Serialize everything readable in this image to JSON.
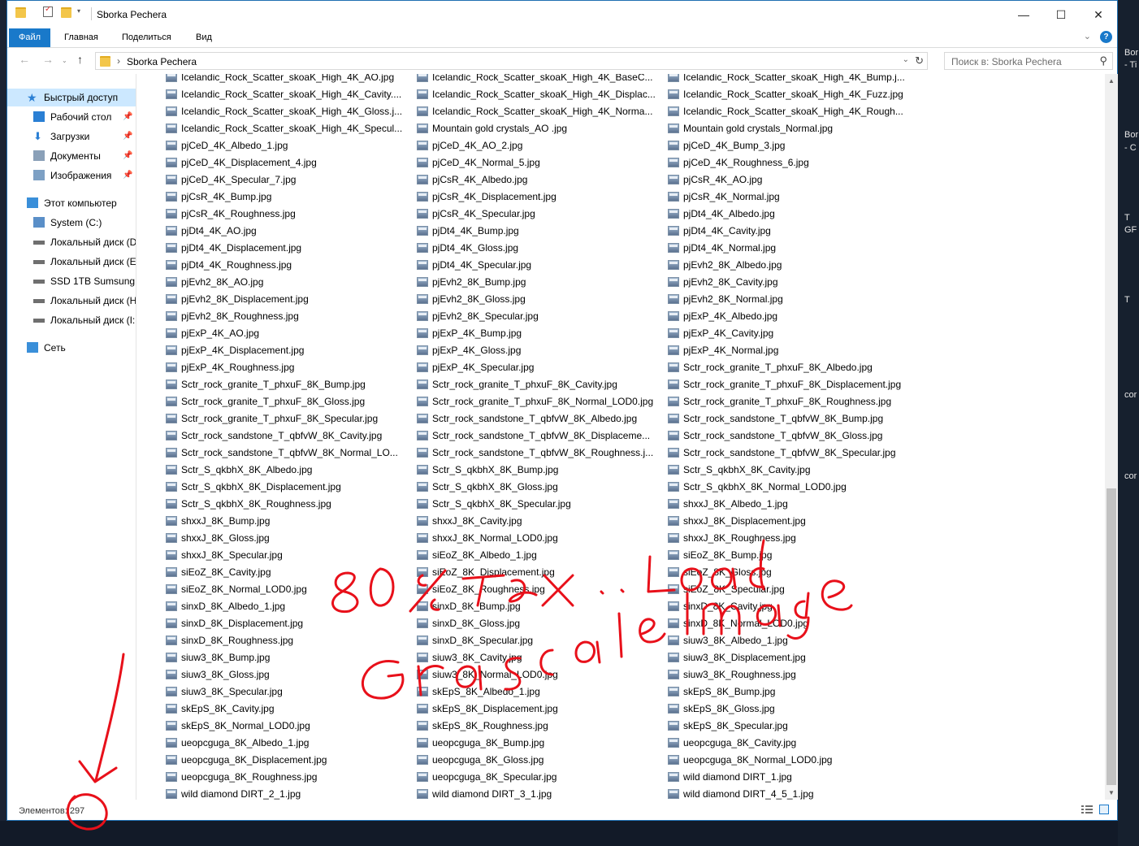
{
  "window": {
    "title": "Sborka Pechera",
    "controls": {
      "minimize": "—",
      "maximize": "☐",
      "close": "✕"
    }
  },
  "ribbon": {
    "tabs": [
      "Файл",
      "Главная",
      "Поделиться",
      "Вид"
    ],
    "help": "?"
  },
  "address": {
    "path": "Sborka Pechera",
    "search_placeholder": "Поиск в: Sborka Pechera"
  },
  "nav": [
    {
      "label": "Быстрый доступ",
      "icon": "star-icon",
      "level": 0,
      "selected": true,
      "pin": false
    },
    {
      "label": "Рабочий стол",
      "icon": "desktop-icon",
      "level": 1,
      "pin": true
    },
    {
      "label": "Загрузки",
      "icon": "download-icon",
      "level": 1,
      "pin": true
    },
    {
      "label": "Документы",
      "icon": "documents-icon",
      "level": 1,
      "pin": true
    },
    {
      "label": "Изображения",
      "icon": "pictures-icon",
      "level": 1,
      "pin": true
    },
    {
      "label": "Этот компьютер",
      "icon": "computer-icon",
      "level": 0,
      "gap": true,
      "pin": false
    },
    {
      "label": "System (C:)",
      "icon": "windows-drive-icon",
      "level": 1,
      "pin": false
    },
    {
      "label": "Локальный диск (D",
      "icon": "drive-icon",
      "level": 1,
      "pin": false
    },
    {
      "label": "Локальный диск (E",
      "icon": "drive-icon",
      "level": 1,
      "pin": false
    },
    {
      "label": "SSD 1TB Sumsung (",
      "icon": "drive-icon",
      "level": 1,
      "pin": false
    },
    {
      "label": "Локальный диск (H",
      "icon": "drive-icon",
      "level": 1,
      "pin": false
    },
    {
      "label": "Локальный диск (I:",
      "icon": "drive-icon",
      "level": 1,
      "pin": false
    },
    {
      "label": "Сеть",
      "icon": "network-icon",
      "level": 0,
      "gap": true,
      "pin": false
    }
  ],
  "files": {
    "col1": [
      "Icelandic_Rock_Scatter_skoaK_High_4K_AO.jpg",
      "Icelandic_Rock_Scatter_skoaK_High_4K_Cavity....",
      "Icelandic_Rock_Scatter_skoaK_High_4K_Gloss.j...",
      "Icelandic_Rock_Scatter_skoaK_High_4K_Specul...",
      "pjCeD_4K_Albedo_1.jpg",
      "pjCeD_4K_Displacement_4.jpg",
      "pjCeD_4K_Specular_7.jpg",
      "pjCsR_4K_Bump.jpg",
      "pjCsR_4K_Roughness.jpg",
      "pjDt4_4K_AO.jpg",
      "pjDt4_4K_Displacement.jpg",
      "pjDt4_4K_Roughness.jpg",
      "pjEvh2_8K_AO.jpg",
      "pjEvh2_8K_Displacement.jpg",
      "pjEvh2_8K_Roughness.jpg",
      "pjExP_4K_AO.jpg",
      "pjExP_4K_Displacement.jpg",
      "pjExP_4K_Roughness.jpg",
      "Sctr_rock_granite_T_phxuF_8K_Bump.jpg",
      "Sctr_rock_granite_T_phxuF_8K_Gloss.jpg",
      "Sctr_rock_granite_T_phxuF_8K_Specular.jpg",
      "Sctr_rock_sandstone_T_qbfvW_8K_Cavity.jpg",
      "Sctr_rock_sandstone_T_qbfvW_8K_Normal_LO...",
      "Sctr_S_qkbhX_8K_Albedo.jpg",
      "Sctr_S_qkbhX_8K_Displacement.jpg",
      "Sctr_S_qkbhX_8K_Roughness.jpg",
      "shxxJ_8K_Bump.jpg",
      "shxxJ_8K_Gloss.jpg",
      "shxxJ_8K_Specular.jpg",
      "siEoZ_8K_Cavity.jpg",
      "siEoZ_8K_Normal_LOD0.jpg",
      "sinxD_8K_Albedo_1.jpg",
      "sinxD_8K_Displacement.jpg",
      "sinxD_8K_Roughness.jpg",
      "siuw3_8K_Bump.jpg",
      "siuw3_8K_Gloss.jpg",
      "siuw3_8K_Specular.jpg",
      "skEpS_8K_Cavity.jpg",
      "skEpS_8K_Normal_LOD0.jpg",
      "ueopcguga_8K_Albedo_1.jpg",
      "ueopcguga_8K_Displacement.jpg",
      "ueopcguga_8K_Roughness.jpg",
      "wild diamond DIRT_2_1.jpg"
    ],
    "col2": [
      "Icelandic_Rock_Scatter_skoaK_High_4K_BaseC...",
      "Icelandic_Rock_Scatter_skoaK_High_4K_Displac...",
      "Icelandic_Rock_Scatter_skoaK_High_4K_Norma...",
      "Mountain gold crystals_AO .jpg",
      "pjCeD_4K_AO_2.jpg",
      "pjCeD_4K_Normal_5.jpg",
      "pjCsR_4K_Albedo.jpg",
      "pjCsR_4K_Displacement.jpg",
      "pjCsR_4K_Specular.jpg",
      "pjDt4_4K_Bump.jpg",
      "pjDt4_4K_Gloss.jpg",
      "pjDt4_4K_Specular.jpg",
      "pjEvh2_8K_Bump.jpg",
      "pjEvh2_8K_Gloss.jpg",
      "pjEvh2_8K_Specular.jpg",
      "pjExP_4K_Bump.jpg",
      "pjExP_4K_Gloss.jpg",
      "pjExP_4K_Specular.jpg",
      "Sctr_rock_granite_T_phxuF_8K_Cavity.jpg",
      "Sctr_rock_granite_T_phxuF_8K_Normal_LOD0.jpg",
      "Sctr_rock_sandstone_T_qbfvW_8K_Albedo.jpg",
      "Sctr_rock_sandstone_T_qbfvW_8K_Displaceme...",
      "Sctr_rock_sandstone_T_qbfvW_8K_Roughness.j...",
      "Sctr_S_qkbhX_8K_Bump.jpg",
      "Sctr_S_qkbhX_8K_Gloss.jpg",
      "Sctr_S_qkbhX_8K_Specular.jpg",
      "shxxJ_8K_Cavity.jpg",
      "shxxJ_8K_Normal_LOD0.jpg",
      "siEoZ_8K_Albedo_1.jpg",
      "siEoZ_8K_Displacement.jpg",
      "siEoZ_8K_Roughness.jpg",
      "sinxD_8K_Bump.jpg",
      "sinxD_8K_Gloss.jpg",
      "sinxD_8K_Specular.jpg",
      "siuw3_8K_Cavity.jpg",
      "siuw3_8K_Normal_LOD0.jpg",
      "skEpS_8K_Albedo_1.jpg",
      "skEpS_8K_Displacement.jpg",
      "skEpS_8K_Roughness.jpg",
      "ueopcguga_8K_Bump.jpg",
      "ueopcguga_8K_Gloss.jpg",
      "ueopcguga_8K_Specular.jpg",
      "wild diamond DIRT_3_1.jpg"
    ],
    "col3": [
      "Icelandic_Rock_Scatter_skoaK_High_4K_Bump.j...",
      "Icelandic_Rock_Scatter_skoaK_High_4K_Fuzz.jpg",
      "Icelandic_Rock_Scatter_skoaK_High_4K_Rough...",
      "Mountain gold crystals_Normal.jpg",
      "pjCeD_4K_Bump_3.jpg",
      "pjCeD_4K_Roughness_6.jpg",
      "pjCsR_4K_AO.jpg",
      "pjCsR_4K_Normal.jpg",
      "pjDt4_4K_Albedo.jpg",
      "pjDt4_4K_Cavity.jpg",
      "pjDt4_4K_Normal.jpg",
      "pjEvh2_8K_Albedo.jpg",
      "pjEvh2_8K_Cavity.jpg",
      "pjEvh2_8K_Normal.jpg",
      "pjExP_4K_Albedo.jpg",
      "pjExP_4K_Cavity.jpg",
      "pjExP_4K_Normal.jpg",
      "Sctr_rock_granite_T_phxuF_8K_Albedo.jpg",
      "Sctr_rock_granite_T_phxuF_8K_Displacement.jpg",
      "Sctr_rock_granite_T_phxuF_8K_Roughness.jpg",
      "Sctr_rock_sandstone_T_qbfvW_8K_Bump.jpg",
      "Sctr_rock_sandstone_T_qbfvW_8K_Gloss.jpg",
      "Sctr_rock_sandstone_T_qbfvW_8K_Specular.jpg",
      "Sctr_S_qkbhX_8K_Cavity.jpg",
      "Sctr_S_qkbhX_8K_Normal_LOD0.jpg",
      "shxxJ_8K_Albedo_1.jpg",
      "shxxJ_8K_Displacement.jpg",
      "shxxJ_8K_Roughness.jpg",
      "siEoZ_8K_Bump.jpg",
      "siEoZ_8K_Gloss.jpg",
      "siEoZ_8K_Specular.jpg",
      "sinxD_8K_Cavity.jpg",
      "sinxD_8K_Normal_LOD0.jpg",
      "siuw3_8K_Albedo_1.jpg",
      "siuw3_8K_Displacement.jpg",
      "siuw3_8K_Roughness.jpg",
      "skEpS_8K_Bump.jpg",
      "skEpS_8K_Gloss.jpg",
      "skEpS_8K_Specular.jpg",
      "ueopcguga_8K_Cavity.jpg",
      "ueopcguga_8K_Normal_LOD0.jpg",
      "wild diamond DIRT_1.jpg",
      "wild diamond DIRT_4_5_1.jpg"
    ]
  },
  "status": {
    "count_text": "Элементов: 297"
  },
  "annotation": {
    "color": "#e8101a"
  },
  "desktop": {
    "texts": [
      "Bor",
      "- Ti",
      "Bor",
      "- C",
      "T",
      "GF",
      "T",
      "cor",
      "cor"
    ]
  },
  "colors": {
    "accent": "#1979ca",
    "selected_bg": "#cce8ff"
  }
}
